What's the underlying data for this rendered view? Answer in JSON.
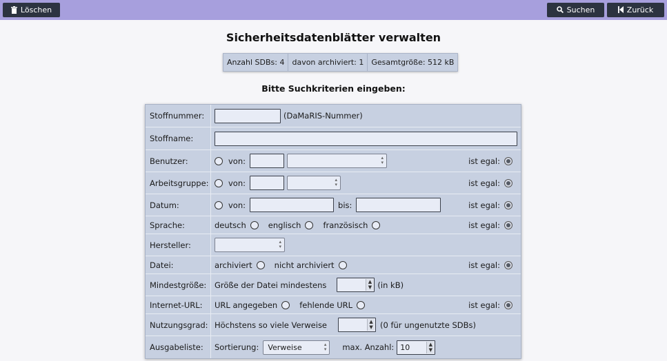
{
  "toolbar": {
    "delete_label": "Löschen",
    "search_label": "Suchen",
    "back_label": "Zurück"
  },
  "page": {
    "title": "Sicherheitsdatenblätter verwalten",
    "subtitle": "Bitte Suchkriterien eingeben:"
  },
  "stats": {
    "count": "Anzahl SDBs: 4",
    "archived": "davon archiviert: 1",
    "total_size": "Gesamtgröße: 512 kB"
  },
  "form": {
    "egal_label": "ist egal:",
    "von_label": "von:",
    "bis_label": "bis:",
    "stoffnummer": {
      "label": "Stoffnummer:",
      "hint": "(DaMaRIS-Nummer)",
      "value": ""
    },
    "stoffname": {
      "label": "Stoffname:",
      "value": ""
    },
    "benutzer": {
      "label": "Benutzer:"
    },
    "arbeitsgruppe": {
      "label": "Arbeitsgruppe:"
    },
    "datum": {
      "label": "Datum:"
    },
    "sprache": {
      "label": "Sprache:",
      "options": [
        "deutsch",
        "englisch",
        "französisch"
      ]
    },
    "hersteller": {
      "label": "Hersteller:"
    },
    "datei": {
      "label": "Datei:",
      "options": [
        "archiviert",
        "nicht archiviert"
      ]
    },
    "mindestgroesse": {
      "label": "Mindestgröße:",
      "text": "Größe der Datei mindestens",
      "unit": "(in kB)"
    },
    "internet_url": {
      "label": "Internet-URL:",
      "options": [
        "URL angegeben",
        "fehlende URL"
      ]
    },
    "nutzungsgrad": {
      "label": "Nutzungsgrad:",
      "text": "Höchstens so viele Verweise",
      "hint": "(0 für ungenutzte SDBs)"
    },
    "ausgabeliste": {
      "label": "Ausgabeliste:",
      "sort_label": "Sortierung:",
      "sort_value": "Verweise",
      "max_label": "max. Anzahl:",
      "max_value": "10"
    }
  }
}
